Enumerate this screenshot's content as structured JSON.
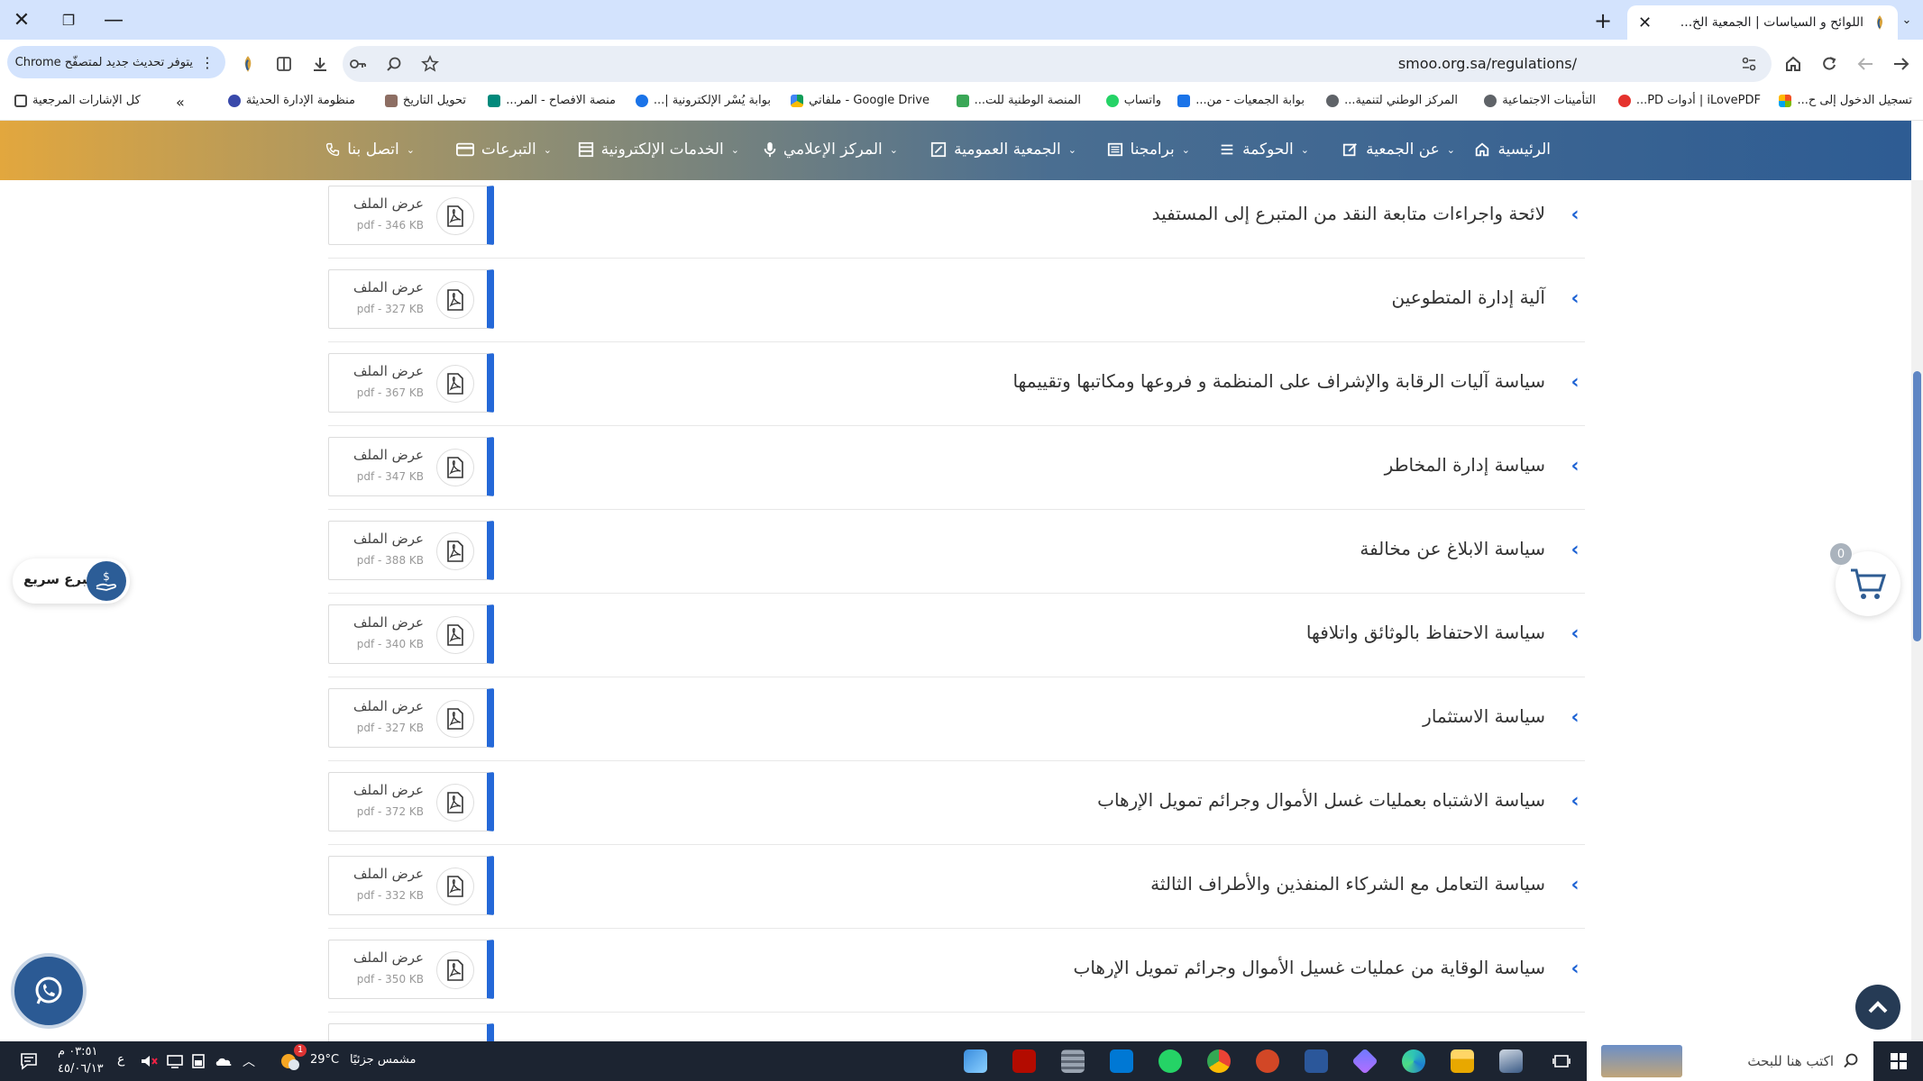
{
  "browser": {
    "tab_title": "اللوائح و السياسات | الجمعية الخ...",
    "url": "smoo.org.sa/regulations/",
    "update_pill_text": "يتوفر تحديث جديد لمتصفّح Chrome"
  },
  "bookmarks": [
    {
      "label": "تسجيل الدخول إلى ح...",
      "color": "#0078d4"
    },
    {
      "label": "iLovePDF | أدوات PD...",
      "color": "#e5322d"
    },
    {
      "label": "التأمينات الاجتماعية",
      "color": "#5f6368"
    },
    {
      "label": "المركز الوطني لتنمية...",
      "color": "#5f6368"
    },
    {
      "label": "بوابة الجمعيات - من...",
      "color": "#1a73e8"
    },
    {
      "label": "واتساب",
      "color": "#25d366"
    },
    {
      "label": "المنصة الوطنية للت...",
      "color": "#3aa757"
    },
    {
      "label": "Google Drive - ملفاتي",
      "color": "#fbbc04"
    },
    {
      "label": "بوابة يُسْر الإلكترونية |...",
      "color": "#1a73e8"
    },
    {
      "label": "منصة الافصاح - المر...",
      "color": "#00897b"
    },
    {
      "label": "تحويل التاريخ",
      "color": "#8d6e63"
    },
    {
      "label": "منظومة الإدارة الحديثة",
      "color": "#3949ab"
    },
    {
      "label": "كل الإشارات المرجعية",
      "color": "#5f6368"
    }
  ],
  "nav": [
    {
      "label": "الرئيسية",
      "icon": "home-icon"
    },
    {
      "label": "عن الجمعية",
      "icon": "edit-icon"
    },
    {
      "label": "الحوكمة",
      "icon": "menu-icon"
    },
    {
      "label": "برامجنا",
      "icon": "list-icon"
    },
    {
      "label": "الجمعية العمومية",
      "icon": "edit-box-icon"
    },
    {
      "label": "المركز الإعلامي",
      "icon": "mic-icon"
    },
    {
      "label": "الخدمات الإلكترونية",
      "icon": "services-icon"
    },
    {
      "label": "التبرعات",
      "icon": "card-icon"
    },
    {
      "label": "اتصل بنا",
      "icon": "phone-icon"
    }
  ],
  "documents": [
    {
      "title": "لائحة واجراءات متابعة النقد من المتبرع إلى المستفيد",
      "view_label": "عرض الملف",
      "meta": "pdf - 346 KB"
    },
    {
      "title": "آلية إدارة المتطوعين",
      "view_label": "عرض الملف",
      "meta": "pdf - 327 KB"
    },
    {
      "title": "سياسة آليات الرقابة والإشراف على المنظمة و فروعها ومكاتبها وتقييمها",
      "view_label": "عرض الملف",
      "meta": "pdf - 367 KB"
    },
    {
      "title": "سياسة إدارة المخاطر",
      "view_label": "عرض الملف",
      "meta": "pdf - 347 KB"
    },
    {
      "title": "سياسة الابلاغ عن مخالفة",
      "view_label": "عرض الملف",
      "meta": "pdf - 388 KB"
    },
    {
      "title": "سياسة الاحتفاظ بالوثائق واتلافها",
      "view_label": "عرض الملف",
      "meta": "pdf - 340 KB"
    },
    {
      "title": "سياسة الاستثمار",
      "view_label": "عرض الملف",
      "meta": "pdf - 327 KB"
    },
    {
      "title": "سياسة الاشتباه بعمليات غسل الأموال وجرائم تمويل الإرهاب",
      "view_label": "عرض الملف",
      "meta": "pdf - 372 KB"
    },
    {
      "title": "سياسة التعامل مع الشركاء المنفذين والأطراف الثالثة",
      "view_label": "عرض الملف",
      "meta": "pdf - 332 KB"
    },
    {
      "title": "سياسة الوقاية من عمليات غسيل الأموال وجرائم تمويل الإرهاب",
      "view_label": "عرض الملف",
      "meta": "pdf - 350 KB"
    }
  ],
  "floating": {
    "quick_donate": "تبرع سريع",
    "cart_count": "0"
  },
  "taskbar": {
    "search_placeholder": "اكتب هنا للبحث",
    "weather_text": "مشمس جزئيًا",
    "temperature": "29°C",
    "time": "٠٣:٥١ م",
    "date": "٤٥/٠٦/١٣",
    "lang": "ع",
    "weather_badge": "1"
  },
  "colors": {
    "accent_blue": "#2468d8",
    "nav_gold": "#e2a73e",
    "nav_blue": "#2e5c93"
  }
}
